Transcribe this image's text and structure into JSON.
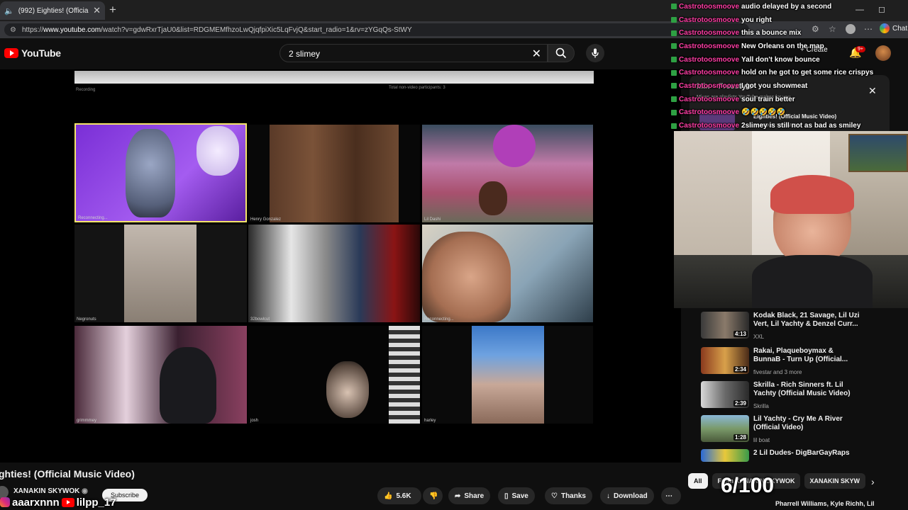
{
  "browser": {
    "tab_title": "(992) Eighties! (Official Music",
    "url_prefix": "https://",
    "url_domain": "www.youtube.com",
    "url_rest": "/watch?v=gdwRxrTjaU0&list=RDGMEMfhzoLwQjqfpiXic5LqFvjQ&start_radio=1&rv=zYGqQs-StWY",
    "chat_label": "Chat"
  },
  "youtube": {
    "logo_text": "YouTube",
    "search_query": "2 slimey",
    "create_label": "Create",
    "notif_count": "9+"
  },
  "video": {
    "participants": [
      {
        "name": "Reconnecting..."
      },
      {
        "name": "Henry Gonzalez"
      },
      {
        "name": "Lil Dashi"
      },
      {
        "name": "Negronuts"
      },
      {
        "name": "32bowlcut"
      },
      {
        "name": "Reconnecting..."
      },
      {
        "name": "grimmmey"
      },
      {
        "name": "josh"
      },
      {
        "name": "harley"
      }
    ],
    "zoom_recording_label": "Recording",
    "zoom_total_label": "Total non-video participants: 3"
  },
  "watch": {
    "title": "ghties! (Official Music Video)",
    "channel": "XANAKIN SKYWOK",
    "subscribe_label": "Subscribe",
    "likes": "5.6K",
    "share_label": "Share",
    "save_label": "Save",
    "thanks_label": "Thanks",
    "download_label": "Download"
  },
  "social_overlay": {
    "instagram": "aaarxnnn",
    "youtube": "lilpp_17"
  },
  "chat": [
    {
      "user": "Castrotoosmoove",
      "msg": "audio delayed by a second"
    },
    {
      "user": "Castrotoosmoove",
      "msg": "you right"
    },
    {
      "user": "Castrotoosmoove",
      "msg": "this a bounce mix"
    },
    {
      "user": "Castrotoosmoove",
      "msg": "New Orleans on the map"
    },
    {
      "user": "Castrotoosmoove",
      "msg": "Yall don't know bounce"
    },
    {
      "user": "Castrotoosmoove",
      "msg": "hold on he got to get some rice crispys"
    },
    {
      "user": "Castrotoosmoove",
      "msg": "I got you showmeat"
    },
    {
      "user": "Castrotoosmoove",
      "msg": "soul train better"
    },
    {
      "user": "Castrotoosmoove",
      "msg": "🤣🤣🤣🤣🤣"
    },
    {
      "user": "Castrotoosmoove",
      "msg": "2slimey is still not as bad as smiley"
    }
  ],
  "mix_panel": {
    "title": "Mix – Freestyle",
    "subtitle": "Mixes are playlists YouTube makes for you",
    "now_playing": "Eighties! (Official Music Video)",
    "now_playing_channel": "XANAKIN SKYWOK"
  },
  "recommended": [
    {
      "title": "Kodak Black, 21 Savage, Lil Uzi Vert, Lil Yachty & Denzel Curr...",
      "channel": "XXL",
      "duration": "4:13"
    },
    {
      "title": "Rakai, Plaqueboymax & BunnaB - Turn Up (Official...",
      "channel": "fivestar and 3 more",
      "duration": "2:34"
    },
    {
      "title": "Skrilla - Rich Sinners ft. Lil Yachty (Official Music Video)",
      "channel": "Skrilla",
      "duration": "2:39"
    },
    {
      "title": "Lil Yachty - Cry Me A River (Official Video)",
      "channel": "lil boat",
      "duration": "1:28"
    },
    {
      "title": "2 Lil Dudes- DigBarGayRaps",
      "channel": "",
      "duration": ""
    }
  ],
  "chips": [
    "All",
    "From XANAKIN SKYWOK",
    "XANAKIN SKYW"
  ],
  "next_preview": "Pharrell Williams, Kyle Richh, Lil",
  "counter": "6/100"
}
